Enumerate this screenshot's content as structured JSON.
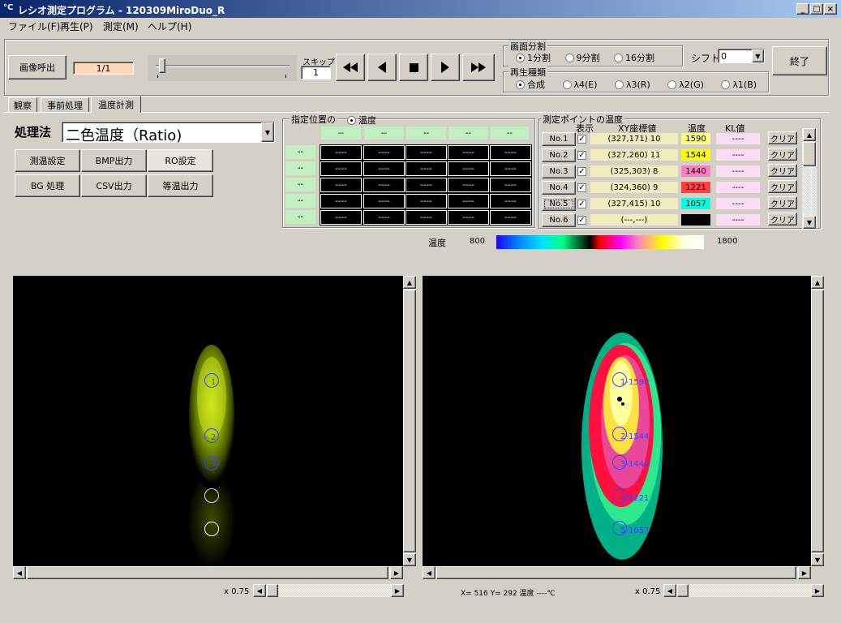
{
  "window": {
    "icon": "°C",
    "title": "レシオ測定プログラム - 120309MiroDuo_R"
  },
  "menu": [
    "ファイル(F)",
    "再生(P)",
    "測定(M)",
    "ヘルプ(H)"
  ],
  "toolbar": {
    "load_button": "画像呼出",
    "frame_counter": "1/1",
    "skip_label": "スキップ",
    "skip_value": "1",
    "exit_button": "終了"
  },
  "screen_split": {
    "title": "画面分割",
    "options": [
      "1分割",
      "9分割",
      "16分割"
    ],
    "selected": "1分割"
  },
  "shift": {
    "label": "シフト",
    "value": "0"
  },
  "playback_type": {
    "title": "再生種類",
    "options": [
      "合成",
      "λ4(E)",
      "λ3(R)",
      "λ2(G)",
      "λ1(B)"
    ],
    "selected": "合成"
  },
  "tabs": [
    "観察",
    "事前処理",
    "温度計測"
  ],
  "active_tab": "温度計測",
  "method": {
    "label": "処理法",
    "value": "二色温度（Ratio)"
  },
  "action_buttons": [
    [
      "測温設定",
      "BMP出力",
      "RO設定"
    ],
    [
      "BG 処理",
      "CSV出力",
      "等温出力"
    ]
  ],
  "position_grid": {
    "title": "指定位置の",
    "radio": "温度",
    "col_headers": [
      "--",
      "--",
      "--",
      "--",
      "--"
    ],
    "row_headers": [
      "--",
      "--",
      "--",
      "--",
      "--"
    ],
    "cell": "----"
  },
  "measure_points": {
    "title": "測定ポイントの温度",
    "headers": {
      "show": "表示",
      "xy": "XY座標値",
      "temp": "温度",
      "kl": "KL値"
    },
    "clear_label": "クリア",
    "rows": [
      {
        "no": "No.1",
        "xy": "(327,171) 10",
        "temp": "1590",
        "color": "#ffff80",
        "kl": "----"
      },
      {
        "no": "No.2",
        "xy": "(327,260) 11",
        "temp": "1544",
        "color": "#ffff00",
        "kl": "----"
      },
      {
        "no": "No.3",
        "xy": "(325,303) 8",
        "temp": "1440",
        "color": "#ff80c0",
        "kl": "----"
      },
      {
        "no": "No.4",
        "xy": "(324,360) 9",
        "temp": "1221",
        "color": "#ff4040",
        "kl": "----"
      },
      {
        "no": "No.5",
        "xy": "(327,415) 10",
        "temp": "1057",
        "color": "#00ffe0",
        "kl": "----"
      },
      {
        "no": "No.6",
        "xy": "(---,---)",
        "temp": "----",
        "color": "#000000",
        "kl": "----"
      }
    ]
  },
  "color_scale": {
    "label": "温度",
    "min": "800",
    "max": "1800"
  },
  "left_view": {
    "zoom": "x 0.75",
    "markers": [
      "1",
      "2",
      "3",
      "",
      ""
    ]
  },
  "right_view": {
    "zoom": "x 0.75",
    "status": "X= 516  Y= 292  温度   ----℃",
    "markers": [
      "1-1590",
      "2-1544",
      "3-1440",
      "4-1221",
      "5-1057"
    ]
  }
}
